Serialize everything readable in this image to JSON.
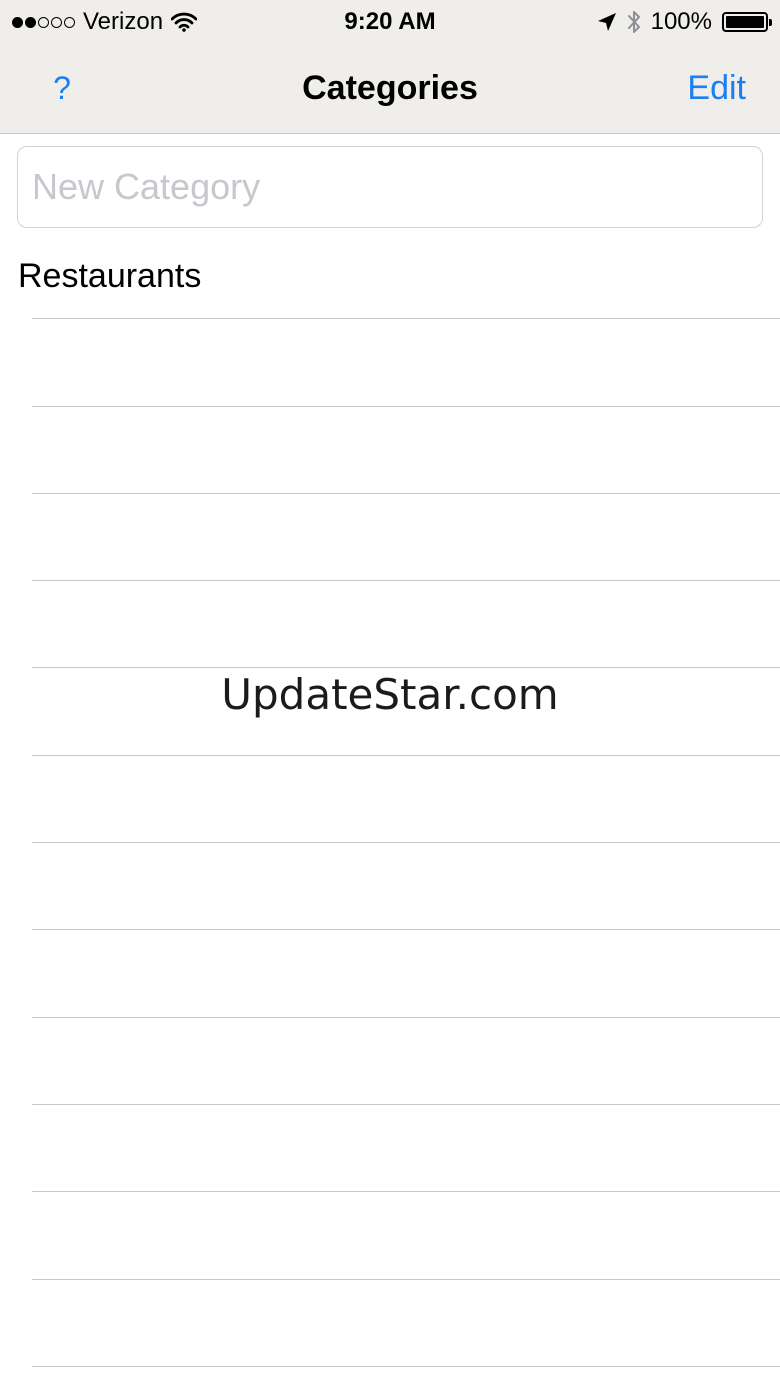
{
  "status_bar": {
    "carrier": "Verizon",
    "signal_bars_filled": 2,
    "signal_bars_total": 5,
    "time": "9:20 AM",
    "battery_percent": "100%",
    "battery_level": 1.0,
    "icons": [
      "wifi-icon",
      "location-arrow-icon",
      "bluetooth-icon",
      "battery-icon"
    ]
  },
  "nav": {
    "left_label": "?",
    "title": "Categories",
    "right_label": "Edit"
  },
  "new_category": {
    "value": "",
    "placeholder": "New Category"
  },
  "categories": [
    {
      "label": "Restaurants"
    },
    {
      "label": ""
    },
    {
      "label": ""
    },
    {
      "label": ""
    },
    {
      "label": ""
    },
    {
      "label": ""
    },
    {
      "label": ""
    },
    {
      "label": ""
    },
    {
      "label": ""
    },
    {
      "label": ""
    },
    {
      "label": ""
    },
    {
      "label": ""
    },
    {
      "label": ""
    },
    {
      "label": ""
    }
  ],
  "watermark": "UpdateStar.com",
  "colors": {
    "accent": "#1a7ff2",
    "bar_background": "#efeeea",
    "separator": "#c8c7cc",
    "placeholder": "#c7c7cd"
  }
}
